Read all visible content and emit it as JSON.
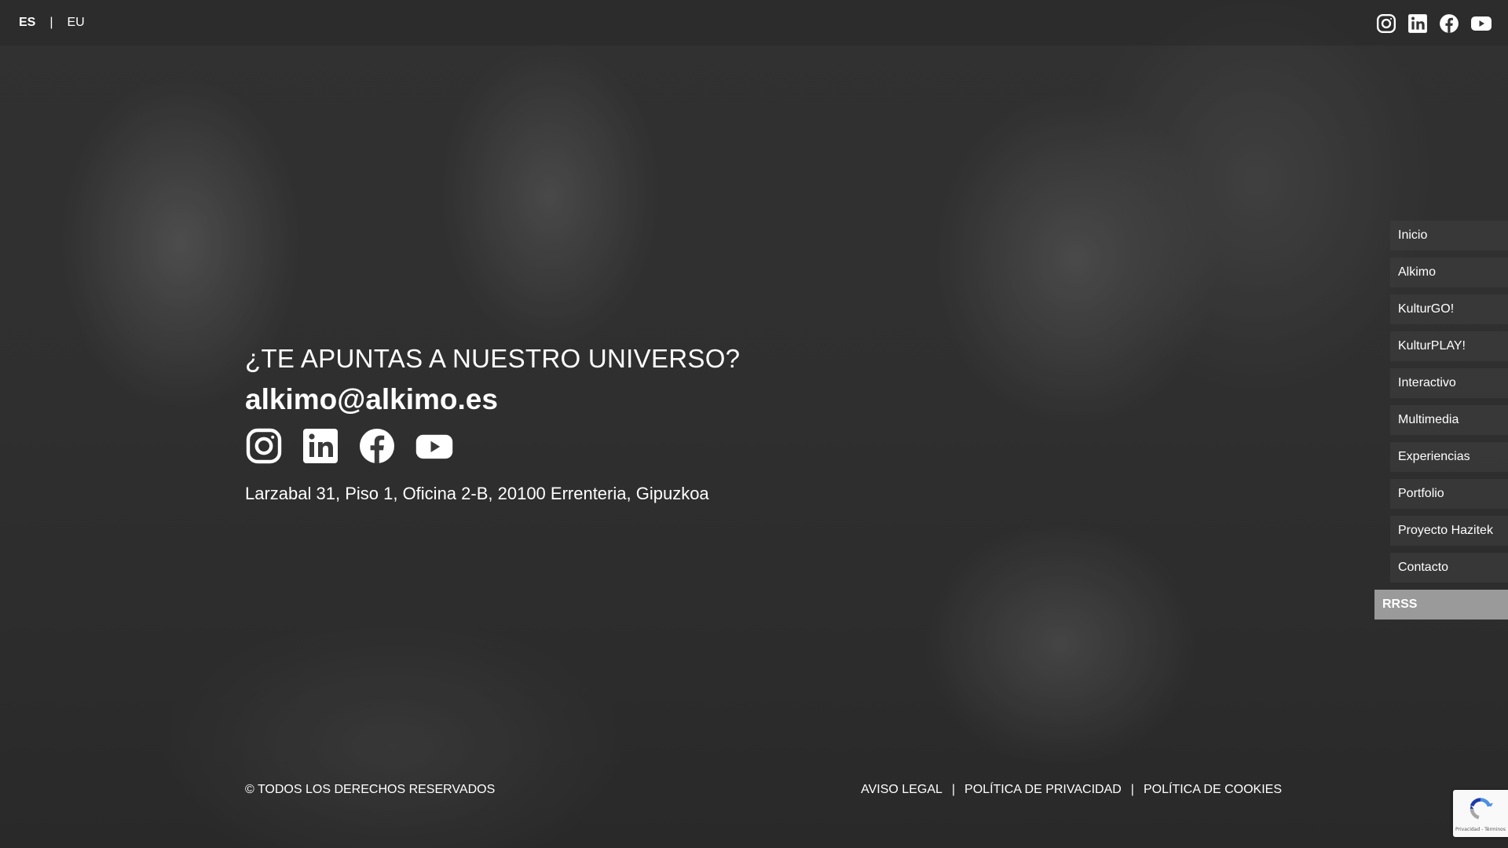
{
  "languages": {
    "active": "ES",
    "separator": "|",
    "other": "EU"
  },
  "social_icons": [
    "instagram-icon",
    "linkedin-icon",
    "facebook-icon",
    "youtube-icon"
  ],
  "main": {
    "headline": "¿TE APUNTAS A NUESTRO UNIVERSO?",
    "email": "alkimo@alkimo.es",
    "address": "Larzabal 31, Piso 1, Oficina 2-B, 20100 Errenteria, Gipuzkoa"
  },
  "sidenav": {
    "items": [
      {
        "label": "Inicio"
      },
      {
        "label": "Alkimo"
      },
      {
        "label": "KulturGO!"
      },
      {
        "label": "KulturPLAY!"
      },
      {
        "label": "Interactivo"
      },
      {
        "label": "Multimedia"
      },
      {
        "label": "Experiencias"
      },
      {
        "label": "Portfolio"
      },
      {
        "label": "Proyecto Hazitek"
      },
      {
        "label": "Contacto"
      },
      {
        "label": "RRSS"
      }
    ],
    "active": "RRSS"
  },
  "footer": {
    "copyright": "© TODOS LOS DERECHOS RESERVADOS",
    "links": [
      "AVISO LEGAL",
      "POLÍTICA DE PRIVACIDAD",
      "POLÍTICA DE COOKIES"
    ],
    "separator": "|"
  },
  "recaptcha": {
    "text": "Privacidad - Términos"
  },
  "colors": {
    "text": "#ffffff",
    "active_nav": "#9a9a9a",
    "nav_bg": "#3c3c3c"
  }
}
